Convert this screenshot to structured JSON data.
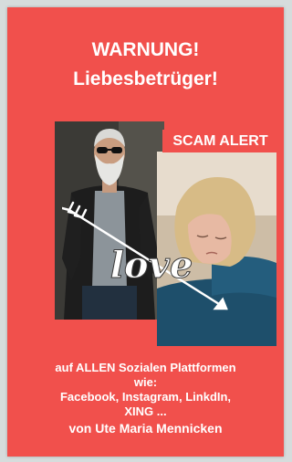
{
  "cover": {
    "title_line1": "WARNUNG!",
    "title_line2": "Liebesbetrüger!",
    "badge": "SCAM ALERT",
    "love_word": "love",
    "subtitle_lines": [
      "auf ALLEN Sozialen Plattformen",
      "wie:",
      "Facebook, Instagram, LinkdIn,",
      "XING ..."
    ],
    "author": "von Ute Maria Mennicken"
  },
  "colors": {
    "background": "#f1504c",
    "text": "#ffffff"
  }
}
